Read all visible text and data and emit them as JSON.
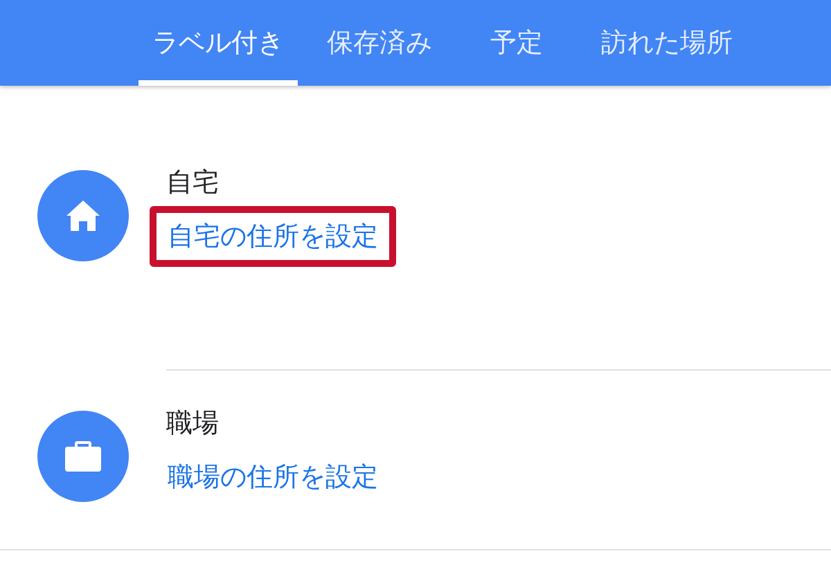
{
  "tabs": [
    {
      "label": "ラベル付き",
      "selected": true
    },
    {
      "label": "保存済み",
      "selected": false
    },
    {
      "label": "予定",
      "selected": false
    },
    {
      "label": "訪れた場所",
      "selected": false
    }
  ],
  "places": [
    {
      "kind": "home",
      "title": "自宅",
      "link": "自宅の住所を設定",
      "highlighted": true
    },
    {
      "kind": "work",
      "title": "職場",
      "link": "職場の住所を設定",
      "highlighted": false
    }
  ]
}
